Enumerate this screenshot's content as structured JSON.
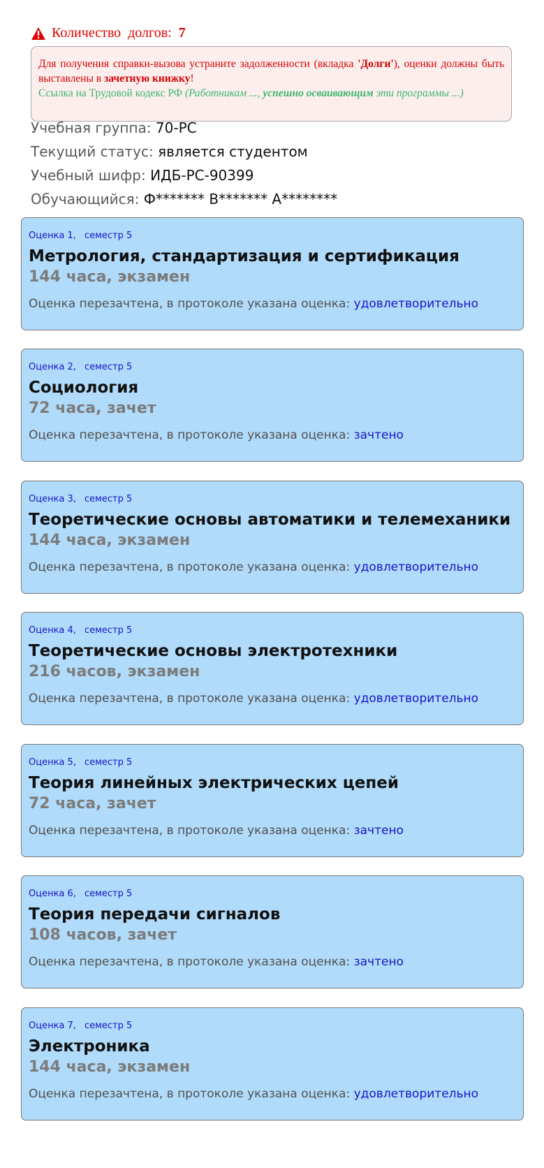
{
  "debt": {
    "label": "Количество долгов:",
    "count": "7"
  },
  "notice": {
    "part1": "Для получения справки-вызова устраните задолженности (вкладка ",
    "tab_name": "'Долги'",
    "part2": "), оценки должны быть выставлены в ",
    "record_book": "зачетную книжку",
    "part3": "!",
    "link_text": "Ссылка на Трудовой кодекс РФ",
    "quote_open": " (Работникам ..., ",
    "quote_bold": "успешно осваивающим",
    "quote_close": " эти программы ...)"
  },
  "student": {
    "group_label": "Учебная группа:",
    "group": "70-РС",
    "status_label": "Текущий статус:",
    "status": "является студентом",
    "cipher_label": "Учебный шифр:",
    "cipher": "ИДБ-РС-90399",
    "name_label": "Обучающийся:",
    "name": "Ф******* В******* А********"
  },
  "result_label": "Оценка перезачтена, в протоколе указана оценка:",
  "grades": [
    {
      "number": "Оценка 1,",
      "semester": "семестр 5",
      "subject": "Метрология, стандартизация и сертификация",
      "hours": "144 часа, экзамен",
      "grade": "удовлетворительно"
    },
    {
      "number": "Оценка 2,",
      "semester": "семестр 5",
      "subject": "Социология",
      "hours": "72 часа, зачет",
      "grade": "зачтено"
    },
    {
      "number": "Оценка 3,",
      "semester": "семестр 5",
      "subject": "Теоретические основы автоматики и телемеханики",
      "hours": "144 часа, экзамен",
      "grade": "удовлетворительно"
    },
    {
      "number": "Оценка 4,",
      "semester": "семестр 5",
      "subject": "Теоретические основы электротехники",
      "hours": "216 часов, экзамен",
      "grade": "удовлетворительно"
    },
    {
      "number": "Оценка 5,",
      "semester": "семестр 5",
      "subject": "Теория линейных электрических цепей",
      "hours": "72 часа, зачет",
      "grade": "зачтено"
    },
    {
      "number": "Оценка 6,",
      "semester": "семестр 5",
      "subject": "Теория передачи сигналов",
      "hours": "108 часов, зачет",
      "grade": "зачтено"
    },
    {
      "number": "Оценка 7,",
      "semester": "семестр 5",
      "subject": "Электроника",
      "hours": "144 часа, экзамен",
      "grade": "удовлетворительно"
    }
  ],
  "colors": {
    "alert_red": "#e00000",
    "notice_bg": "#fdeeee",
    "link_green": "#3bb56b",
    "card_bg": "#b1dbfa",
    "meta_blue": "#1515c8"
  },
  "icons": {
    "warning": "warning-triangle-icon"
  }
}
